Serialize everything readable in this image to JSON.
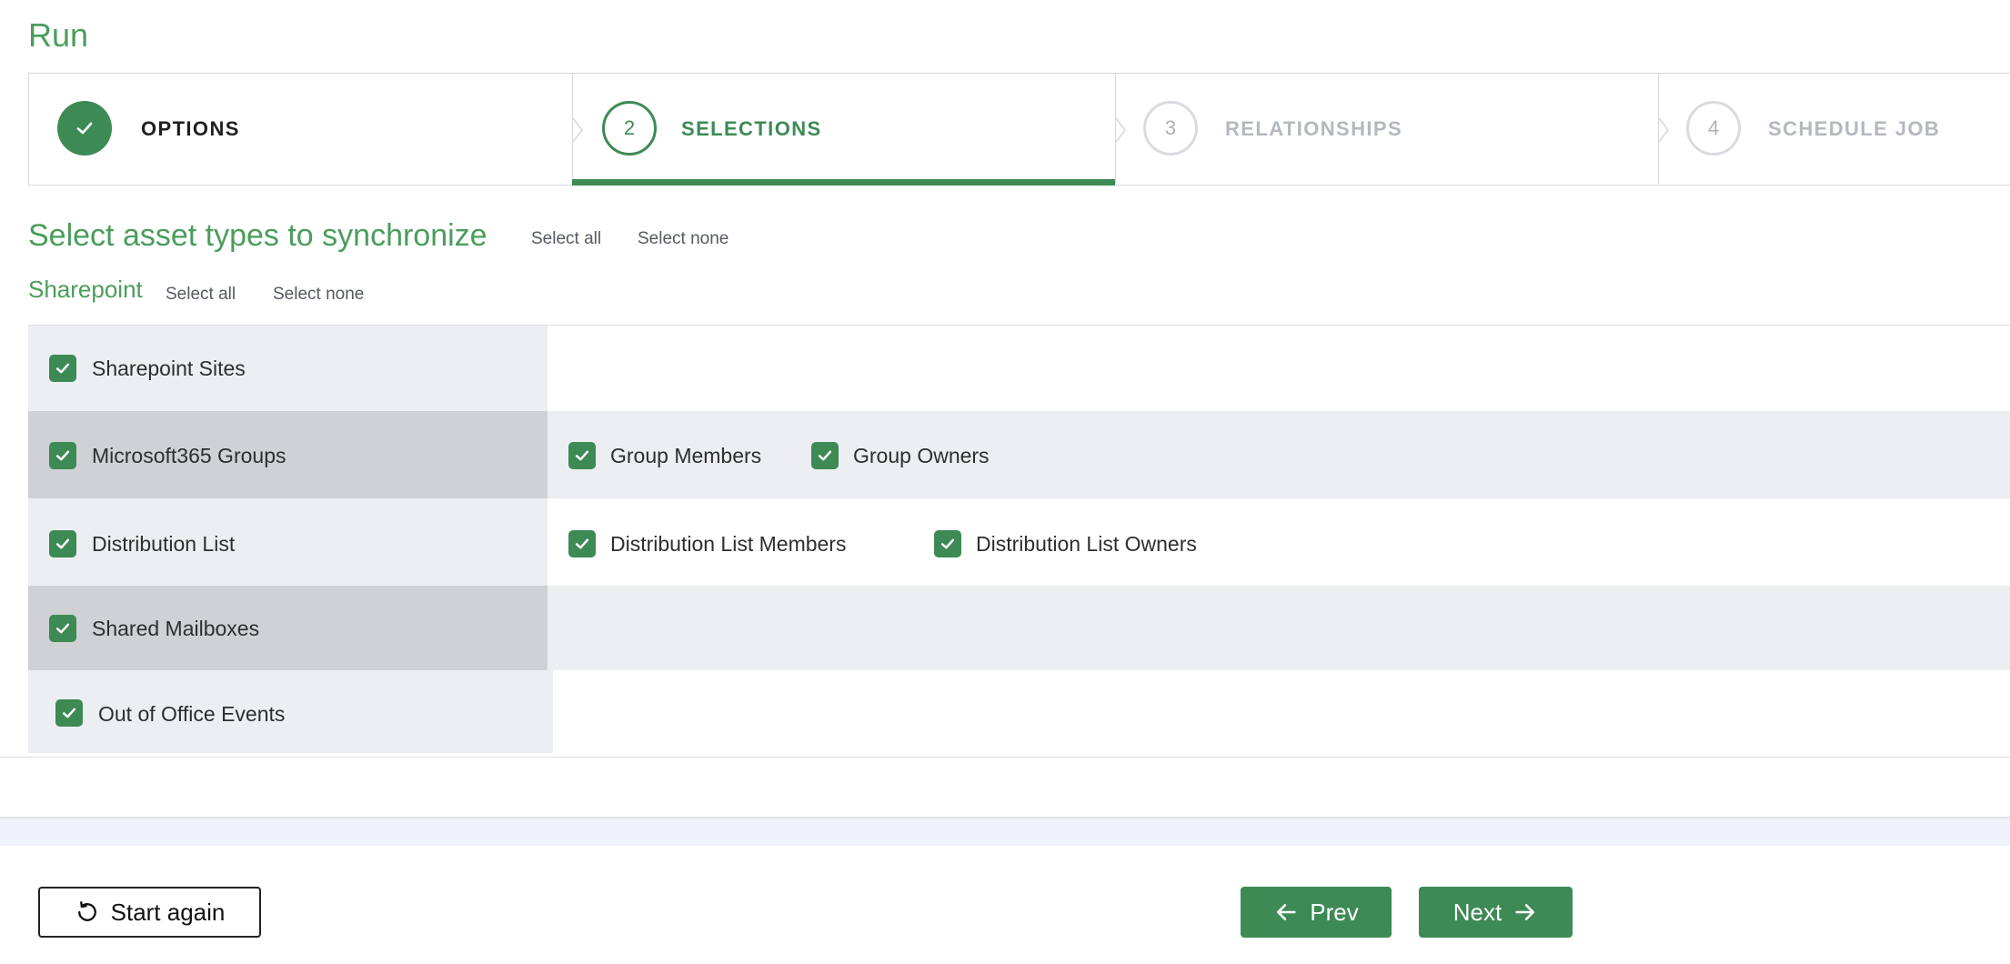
{
  "page": {
    "title": "Run"
  },
  "stepper": {
    "steps": [
      {
        "number": "1",
        "label": "OPTIONS",
        "status": "completed"
      },
      {
        "number": "2",
        "label": "SELECTIONS",
        "status": "current"
      },
      {
        "number": "3",
        "label": "RELATIONSHIPS",
        "status": "upcoming"
      },
      {
        "number": "4",
        "label": "SCHEDULE JOB",
        "status": "upcoming"
      }
    ]
  },
  "selection": {
    "title": "Select asset types to synchronize",
    "select_all": "Select all",
    "select_none": "Select none"
  },
  "sharepoint": {
    "title": "Sharepoint",
    "select_all": "Select all",
    "select_none": "Select none",
    "rows": [
      {
        "label": "Sharepoint Sites",
        "checked": true,
        "sub": []
      },
      {
        "label": "Microsoft365 Groups",
        "checked": true,
        "sub": [
          {
            "label": "Group Members",
            "checked": true
          },
          {
            "label": "Group Owners",
            "checked": true
          }
        ]
      },
      {
        "label": "Distribution List",
        "checked": true,
        "sub": [
          {
            "label": "Distribution List Members",
            "checked": true
          },
          {
            "label": "Distribution List Owners",
            "checked": true
          }
        ]
      },
      {
        "label": "Shared Mailboxes",
        "checked": true,
        "sub": []
      },
      {
        "label": "Out of Office Events",
        "checked": true,
        "sub": []
      }
    ]
  },
  "buttons": {
    "start_again": "Start again",
    "prev": "Prev",
    "next": "Next"
  },
  "colors": {
    "accent": "#3d8a55",
    "title_green": "#4a9d5b",
    "muted": "#b4b8bf"
  },
  "icons": {
    "check": "check-icon",
    "restart": "restart-icon",
    "arrow_left": "arrow-left-icon",
    "arrow_right": "arrow-right-icon"
  }
}
